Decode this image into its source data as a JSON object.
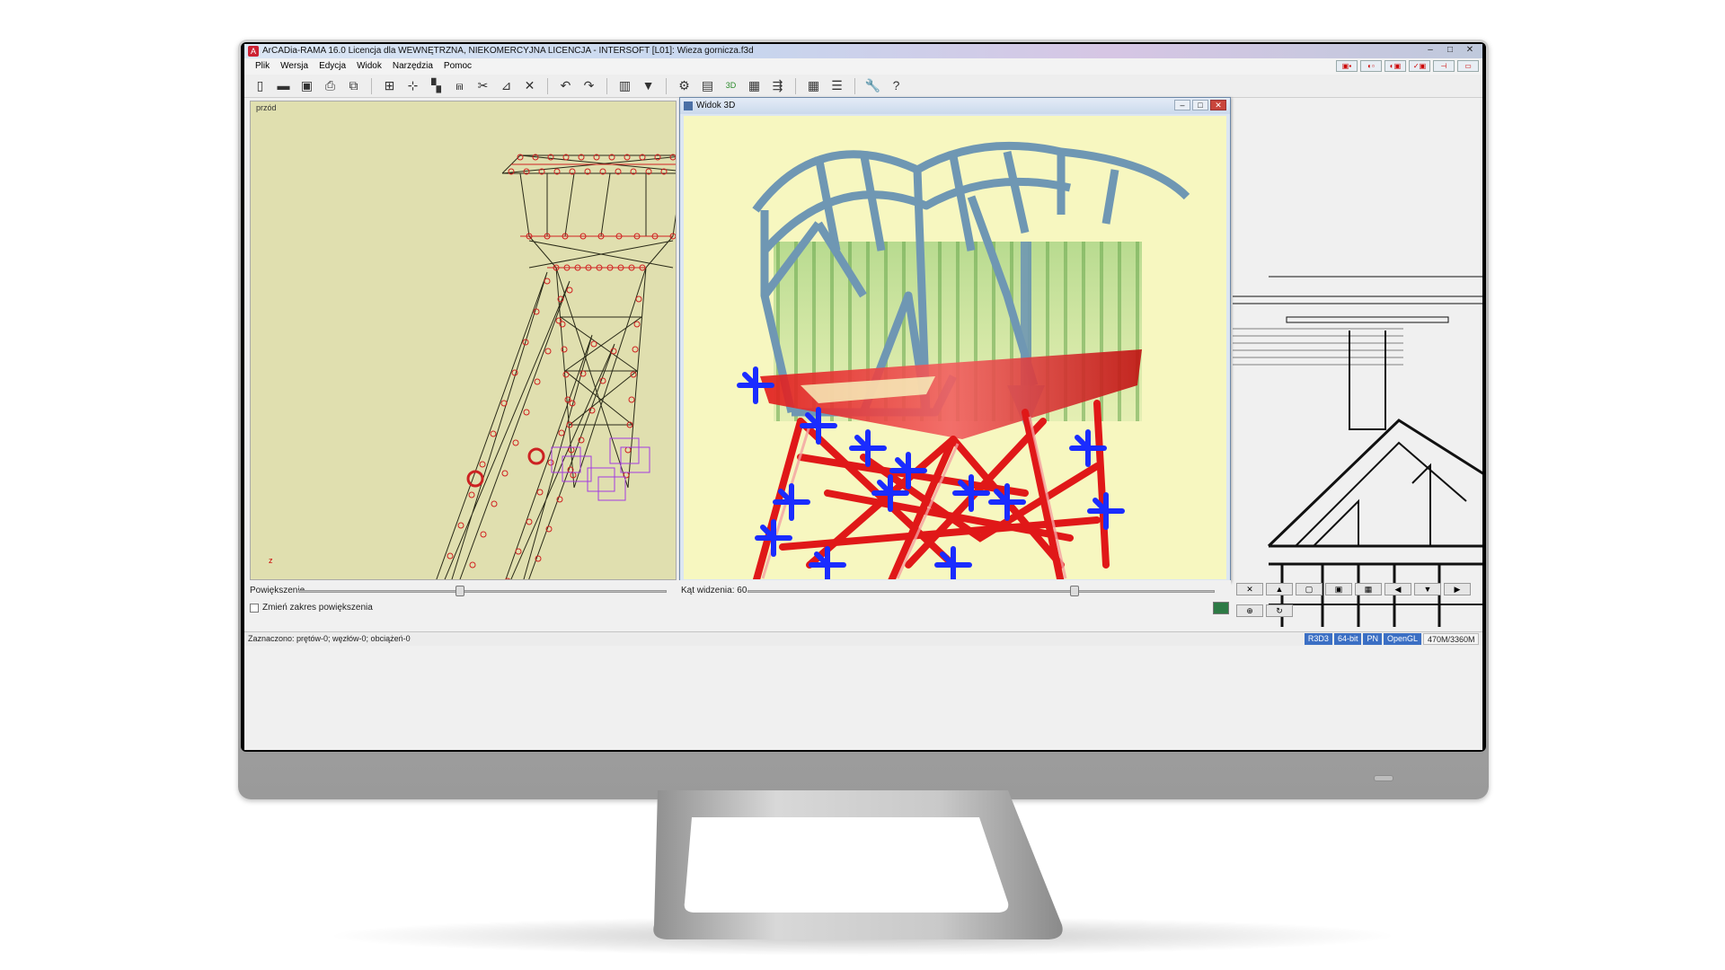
{
  "window": {
    "title": "ArCADia-RAMA 16.0 Licencja dla WEWNĘTRZNA, NIEKOMERCYJNA LICENCJA - INTERSOFT [L01]: Wieza gornicza.f3d",
    "minimize": "–",
    "maximize": "□",
    "close": "✕"
  },
  "menu": [
    "Plik",
    "Wersja",
    "Edycja",
    "Widok",
    "Narzędzia",
    "Pomoc"
  ],
  "left_view": {
    "label": "przód",
    "axis": "z"
  },
  "view3d": {
    "title": "Widok 3D"
  },
  "zoom": {
    "zoom_label": "Powiększenie",
    "zoom_level": 0.44,
    "angle_label": "Kąt widzenia: 60",
    "angle_level": 0.7,
    "checkbox_label": "Zmień zakres powiększenia"
  },
  "status": {
    "selection": "Zaznaczono: prętów-0; węzłów-0; obciążeń-0",
    "badges": [
      "R3D3",
      "64-bit",
      "PN",
      "OpenGL"
    ],
    "memory": "470M/3360M"
  },
  "colors": {
    "structure_red": "#e01818",
    "support_blue": "#1a2cff",
    "frame_blue": "#6f97b3",
    "view_bg": "#f7f7c0",
    "left_bg": "#e0dfaf"
  },
  "icons": [
    "new-file-icon",
    "open-icon",
    "save-icon",
    "print-icon",
    "export-icon",
    "grid-icon",
    "node-icon",
    "bar-icon",
    "support-icon",
    "cut-icon",
    "merge-icon",
    "delete-icon",
    "undo-icon",
    "redo-icon",
    "table-icon",
    "filter-icon",
    "calculate-icon",
    "view-icon",
    "view3d-icon",
    "results-icon",
    "section-icon",
    "calculator-icon",
    "report-icon",
    "settings-icon",
    "help-icon"
  ]
}
